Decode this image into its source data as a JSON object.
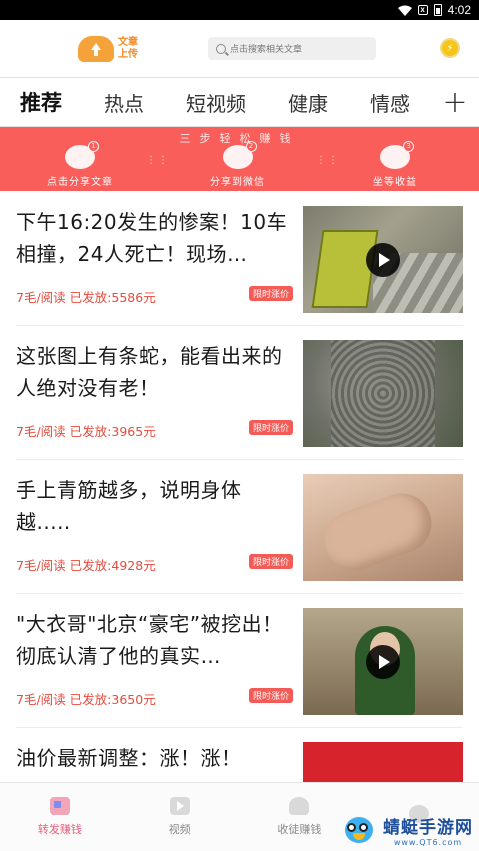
{
  "status_bar": {
    "time": "4:02",
    "sim_badge": "x"
  },
  "header": {
    "logo_text": "文章上传",
    "search_placeholder": "点击搜索相关文章",
    "coin_symbol": "⚡"
  },
  "tabs": [
    "推荐",
    "热点",
    "短视频",
    "健康",
    "情感"
  ],
  "tab_add_symbol": "+",
  "banner": {
    "title": "三步轻松赚钱",
    "steps": [
      {
        "num": "1",
        "label": "点击分享文章"
      },
      {
        "num": "2",
        "label": "分享到微信"
      },
      {
        "num": "3",
        "label": "坐等收益"
      }
    ]
  },
  "feed": [
    {
      "title": "下午16:20发生的惨案！10车相撞，24人死亡！现场…",
      "price": "7毛/阅读",
      "shares": "已发放:5586元",
      "badge": "限时涨价",
      "has_video": true
    },
    {
      "title": "这张图上有条蛇，能看出来的人绝对没有老！",
      "price": "7毛/阅读",
      "shares": "已发放:3965元",
      "badge": "限时涨价",
      "has_video": false
    },
    {
      "title": "手上青筋越多，说明身体越.....",
      "price": "7毛/阅读",
      "shares": "已发放:4928元",
      "badge": "限时涨价",
      "has_video": false
    },
    {
      "title": "\"大衣哥\"北京“豪宅”被挖出！彻底认清了他的真实…",
      "price": "7毛/阅读",
      "shares": "已发放:3650元",
      "badge": "限时涨价",
      "has_video": true
    },
    {
      "title": "油价最新调整：涨！涨！",
      "price": "",
      "shares": "",
      "badge": "",
      "has_video": false
    }
  ],
  "bottom_nav": [
    {
      "label": "转发赚钱",
      "icon": "article-icon",
      "active": true
    },
    {
      "label": "视频",
      "icon": "video-icon",
      "active": false
    },
    {
      "label": "收徒赚钱",
      "icon": "user-icon",
      "active": false
    },
    {
      "label": "",
      "icon": "face-icon",
      "active": false
    }
  ],
  "watermark": {
    "title": "蜻蜓手游网",
    "site": "www.QT6.com"
  },
  "colors": {
    "accent": "#f95e5b",
    "price": "#e84b3c",
    "nav_active": "#e75f7c"
  }
}
